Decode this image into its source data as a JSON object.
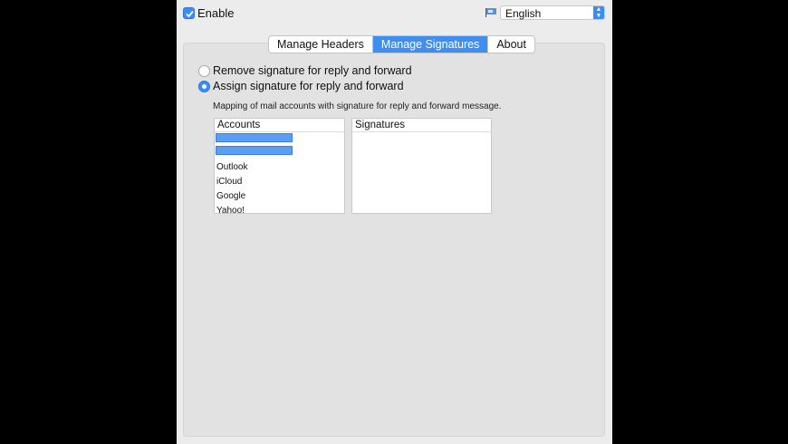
{
  "topbar": {
    "enable_label": "Enable",
    "enable_checked": true,
    "language": "English"
  },
  "tabs": [
    {
      "label": "Manage Headers",
      "active": false
    },
    {
      "label": "Manage Signatures",
      "active": true
    },
    {
      "label": "About",
      "active": false
    }
  ],
  "options": {
    "remove_label": "Remove signature for reply and forward",
    "assign_label": "Assign signature for reply and forward",
    "selected": "assign"
  },
  "mapping": {
    "description": "Mapping of mail accounts with signature for reply and forward message.",
    "accounts_header": "Accounts",
    "signatures_header": "Signatures",
    "accounts": [
      "Outlook",
      "iCloud",
      "Google",
      "Yahoo!"
    ]
  },
  "colors": {
    "accent": "#3f8ef2"
  }
}
